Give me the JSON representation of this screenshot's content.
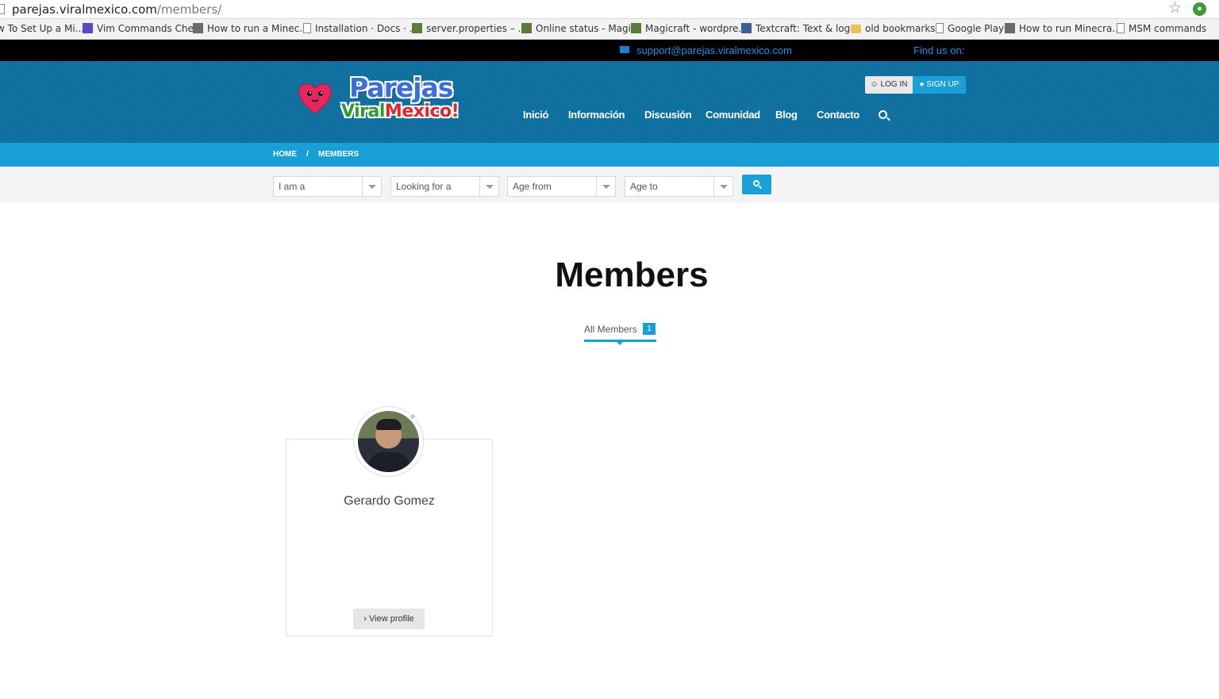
{
  "browser": {
    "url_host": "parejas.viralmexico.com",
    "url_path": "/members/",
    "bookmarks": [
      {
        "label": "w To Set Up a Mi...",
        "icon": "doc-icon"
      },
      {
        "label": "Vim Commands Che...",
        "icon": "vim-icon"
      },
      {
        "label": "How to run a Minec...",
        "icon": "site-icon"
      },
      {
        "label": "Installation · Docs · ...",
        "icon": "doc-icon"
      },
      {
        "label": "server.properties – ...",
        "icon": "cube-icon"
      },
      {
        "label": "Online status - Magi...",
        "icon": "cube-icon"
      },
      {
        "label": "Magicraft - wordpre...",
        "icon": "cube-icon"
      },
      {
        "label": "Textcraft: Text & log...",
        "icon": "tx-icon"
      },
      {
        "label": "old bookmarks",
        "icon": "folder-icon"
      },
      {
        "label": "Google Play",
        "icon": "doc-icon"
      },
      {
        "label": "How to run Minecra...",
        "icon": "site-icon"
      },
      {
        "label": "MSM commands",
        "icon": "doc-icon"
      }
    ]
  },
  "topbar": {
    "email": "support@parejas.viralmexico.com",
    "find_us": "Find us on:"
  },
  "logo": {
    "line1": "Parejas",
    "line2a": "Viral",
    "line2b": "Mexico!"
  },
  "auth": {
    "login": "LOG IN",
    "signup": "SIGN UP"
  },
  "nav": {
    "items": [
      "Inició",
      "Información",
      "Discusión",
      "Comunidad",
      "Blog",
      "Contacto"
    ]
  },
  "breadcrumb": {
    "home": "HOME",
    "separator": "/",
    "current": "MEMBERS"
  },
  "filters": {
    "i_am": "I am a",
    "looking_for": "Looking for a",
    "age_from": "Age from",
    "age_to": "Age to"
  },
  "page": {
    "title": "Members",
    "tab_label": "All Members",
    "tab_count": "1"
  },
  "members": [
    {
      "name": "Gerardo Gomez",
      "button": "› View profile"
    }
  ],
  "colors": {
    "header": "#0d6f9e",
    "accent": "#18a0d6",
    "topbar": "#000000"
  }
}
